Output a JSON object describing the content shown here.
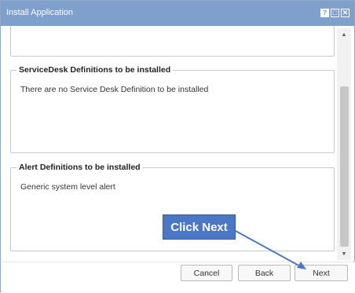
{
  "window": {
    "title": "Install Application",
    "controls": {
      "help_icon": "question-icon",
      "maximize_icon": "maximize-icon",
      "close_icon": "close-icon"
    }
  },
  "sections": [
    {
      "title": "ServiceDesk Definitions to be installed",
      "text": "There are no Service Desk Definition to be installed"
    },
    {
      "title": "Alert Definitions to be installed",
      "text": "Generic system level alert"
    }
  ],
  "footer": {
    "cancel_label": "Cancel",
    "back_label": "Back",
    "next_label": "Next"
  },
  "annotation": {
    "label": "Click Next"
  },
  "colors": {
    "titlebar": "#7f9fcc",
    "callout": "#4a78c7"
  }
}
